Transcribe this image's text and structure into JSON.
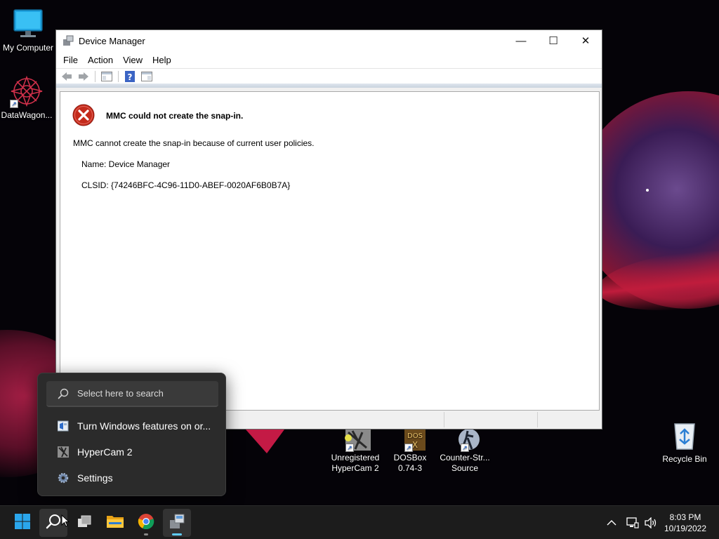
{
  "desktop": {
    "icons": [
      {
        "label": "My Computer"
      },
      {
        "label": "DataWagon..."
      },
      {
        "label": "Unregistered HyperCam 2"
      },
      {
        "label": "DOSBox 0.74-3"
      },
      {
        "label": "Counter-Str... Source"
      },
      {
        "label": "Recycle Bin"
      }
    ]
  },
  "window": {
    "title": "Device Manager",
    "controls": {
      "minimize": "—",
      "maximize": "☐",
      "close": "✕"
    },
    "menu": [
      "File",
      "Action",
      "View",
      "Help"
    ],
    "toolbar_icons": [
      "back-icon",
      "forward-icon",
      "show-hide-console-tree-icon",
      "help-icon",
      "show-action-pane-icon"
    ],
    "error": {
      "title": "MMC could not create the snap-in.",
      "message": "MMC cannot create the snap-in because of current user policies.",
      "name_line": "Name: Device Manager",
      "clsid_line": "CLSID: {74246BFC-4C96-11D0-ABEF-0020AF6B0B7A}"
    }
  },
  "flyout": {
    "search_placeholder": "Select here to search",
    "items": [
      {
        "label": "Turn Windows features on or...",
        "icon": "windows-features-icon"
      },
      {
        "label": "HyperCam 2",
        "icon": "hypercam-icon"
      },
      {
        "label": "Settings",
        "icon": "gear-icon"
      }
    ]
  },
  "taskbar": {
    "apps": [
      "start-icon",
      "search-icon",
      "task-view-icon",
      "file-explorer-icon",
      "chrome-icon",
      "device-manager-icon"
    ],
    "tray_icons": [
      "chevron-up-icon",
      "network-icon",
      "volume-icon"
    ],
    "time": "8:03 PM",
    "date": "10/19/2022"
  },
  "colors": {
    "accent": "#60cdff",
    "error_red": "#c42b1c",
    "flyout_bg": "#2b2b2b",
    "taskbar_bg": "#1c1c1c"
  }
}
